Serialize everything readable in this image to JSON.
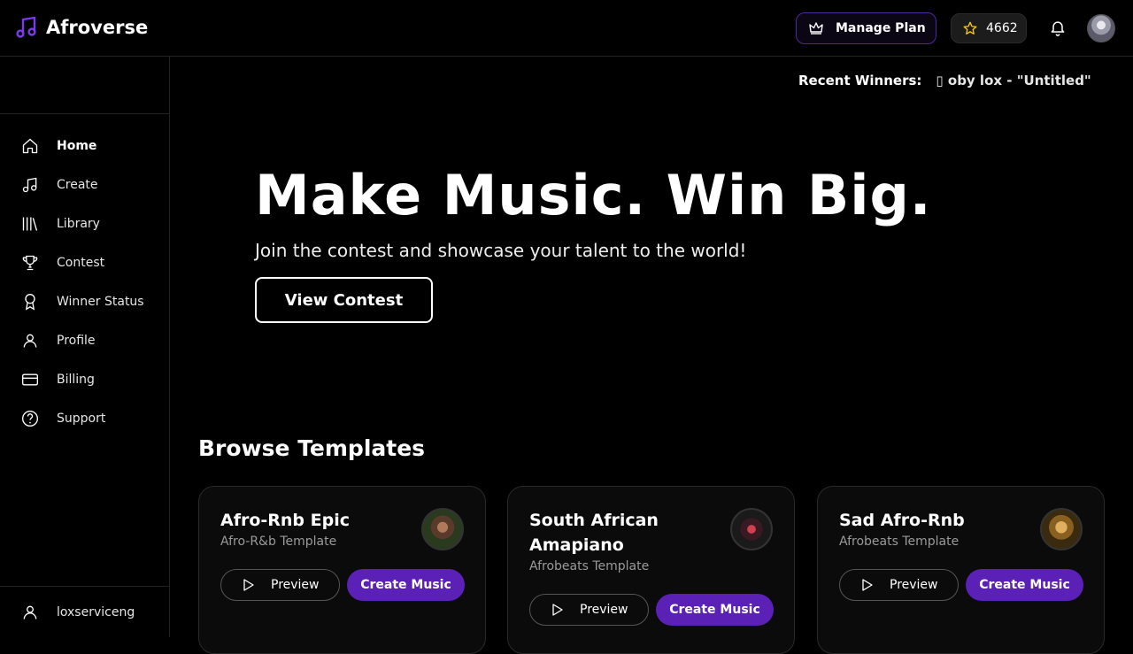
{
  "app": {
    "name": "Afroverse"
  },
  "header": {
    "manage_plan_label": "Manage Plan",
    "credits": "4662"
  },
  "sidebar": {
    "items": [
      {
        "label": "Home",
        "icon": "home-icon",
        "active": true
      },
      {
        "label": "Create",
        "icon": "music-note-icon"
      },
      {
        "label": "Library",
        "icon": "library-icon"
      },
      {
        "label": "Contest",
        "icon": "trophy-icon"
      },
      {
        "label": "Winner Status",
        "icon": "award-icon"
      },
      {
        "label": "Profile",
        "icon": "user-icon"
      },
      {
        "label": "Billing",
        "icon": "credit-card-icon"
      },
      {
        "label": "Support",
        "icon": "help-circle-icon"
      }
    ],
    "username": "loxserviceng"
  },
  "winners": {
    "label": "Recent Winners:",
    "entry": "▯ oby lox - \"Untitled\""
  },
  "hero": {
    "title": "Make Music. Win Big.",
    "subtitle": "Join the contest and showcase your talent to the world!",
    "cta": "View Contest"
  },
  "templates": {
    "title": "Browse Templates",
    "preview_label": "Preview",
    "create_label": "Create Music",
    "cards": [
      {
        "name": "Afro-Rnb Epic",
        "type": "Afro-R&b Template"
      },
      {
        "name": "South African Amapiano",
        "type": "Afrobeats Template"
      },
      {
        "name": "Sad Afro-Rnb",
        "type": "Afrobeats Template"
      }
    ]
  },
  "colors": {
    "accent": "#5b21b6",
    "brand_icon": "#7c3aed",
    "star": "#facc15"
  }
}
